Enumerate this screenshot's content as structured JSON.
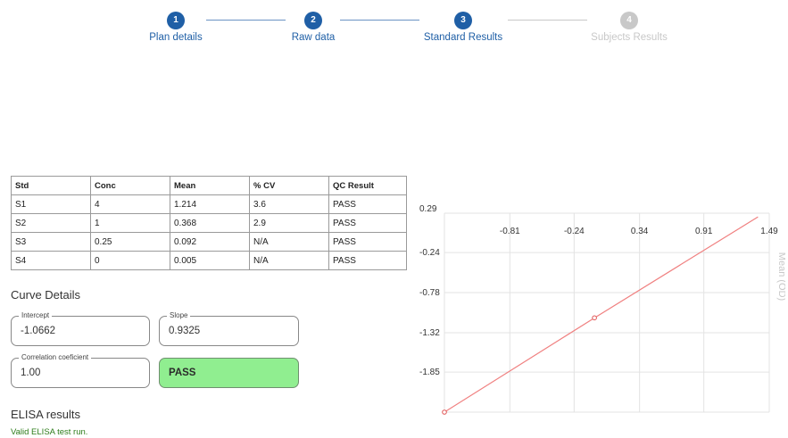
{
  "stepper": {
    "steps": [
      {
        "number": "1",
        "label": "Plan details",
        "state": "done"
      },
      {
        "number": "2",
        "label": "Raw data",
        "state": "done"
      },
      {
        "number": "3",
        "label": "Standard Results",
        "state": "done"
      },
      {
        "number": "4",
        "label": "Subjects Results",
        "state": "todo"
      }
    ]
  },
  "table": {
    "headers": [
      "Std",
      "Conc",
      "Mean",
      "% CV",
      "QC Result"
    ],
    "rows": [
      [
        "S1",
        "4",
        "1.214",
        "3.6",
        "PASS"
      ],
      [
        "S2",
        "1",
        "0.368",
        "2.9",
        "PASS"
      ],
      [
        "S3",
        "0.25",
        "0.092",
        "N/A",
        "PASS"
      ],
      [
        "S4",
        "0",
        "0.005",
        "N/A",
        "PASS"
      ]
    ]
  },
  "curve": {
    "title": "Curve Details",
    "intercept_label": "Intercept",
    "intercept_value": "-1.0662",
    "slope_label": "Slope",
    "slope_value": "0.9325",
    "correlation_label": "Correlation coeficient",
    "correlation_value": "1.00",
    "result_value": "PASS"
  },
  "elisa": {
    "title": "ELISA results",
    "message": "Valid ELISA test run."
  },
  "colors": {
    "step_done": "#1f5fa6",
    "step_todo": "#c8c8c8",
    "pass_green": "#90ee90",
    "line_red": "#f08080",
    "valid_text": "#2e7d1b"
  },
  "chart_data": {
    "type": "line",
    "ylabel": "Mean (OD)",
    "x_ticks": [
      "-0.81",
      "-0.24",
      "0.34",
      "0.91",
      "1.49"
    ],
    "y_ticks": [
      "0.29",
      "-0.24",
      "-0.78",
      "-1.32",
      "-1.85"
    ],
    "xlim": [
      -1.39,
      1.49
    ],
    "ylim": [
      -2.39,
      0.29
    ],
    "series": [
      {
        "x": [
          -1.39,
          -0.06,
          1.39
        ],
        "y": [
          -2.39,
          -1.12,
          0.24
        ]
      }
    ],
    "markers": [
      {
        "x": -1.39,
        "y": -2.39
      },
      {
        "x": -0.06,
        "y": -1.12
      }
    ],
    "grid": true
  }
}
